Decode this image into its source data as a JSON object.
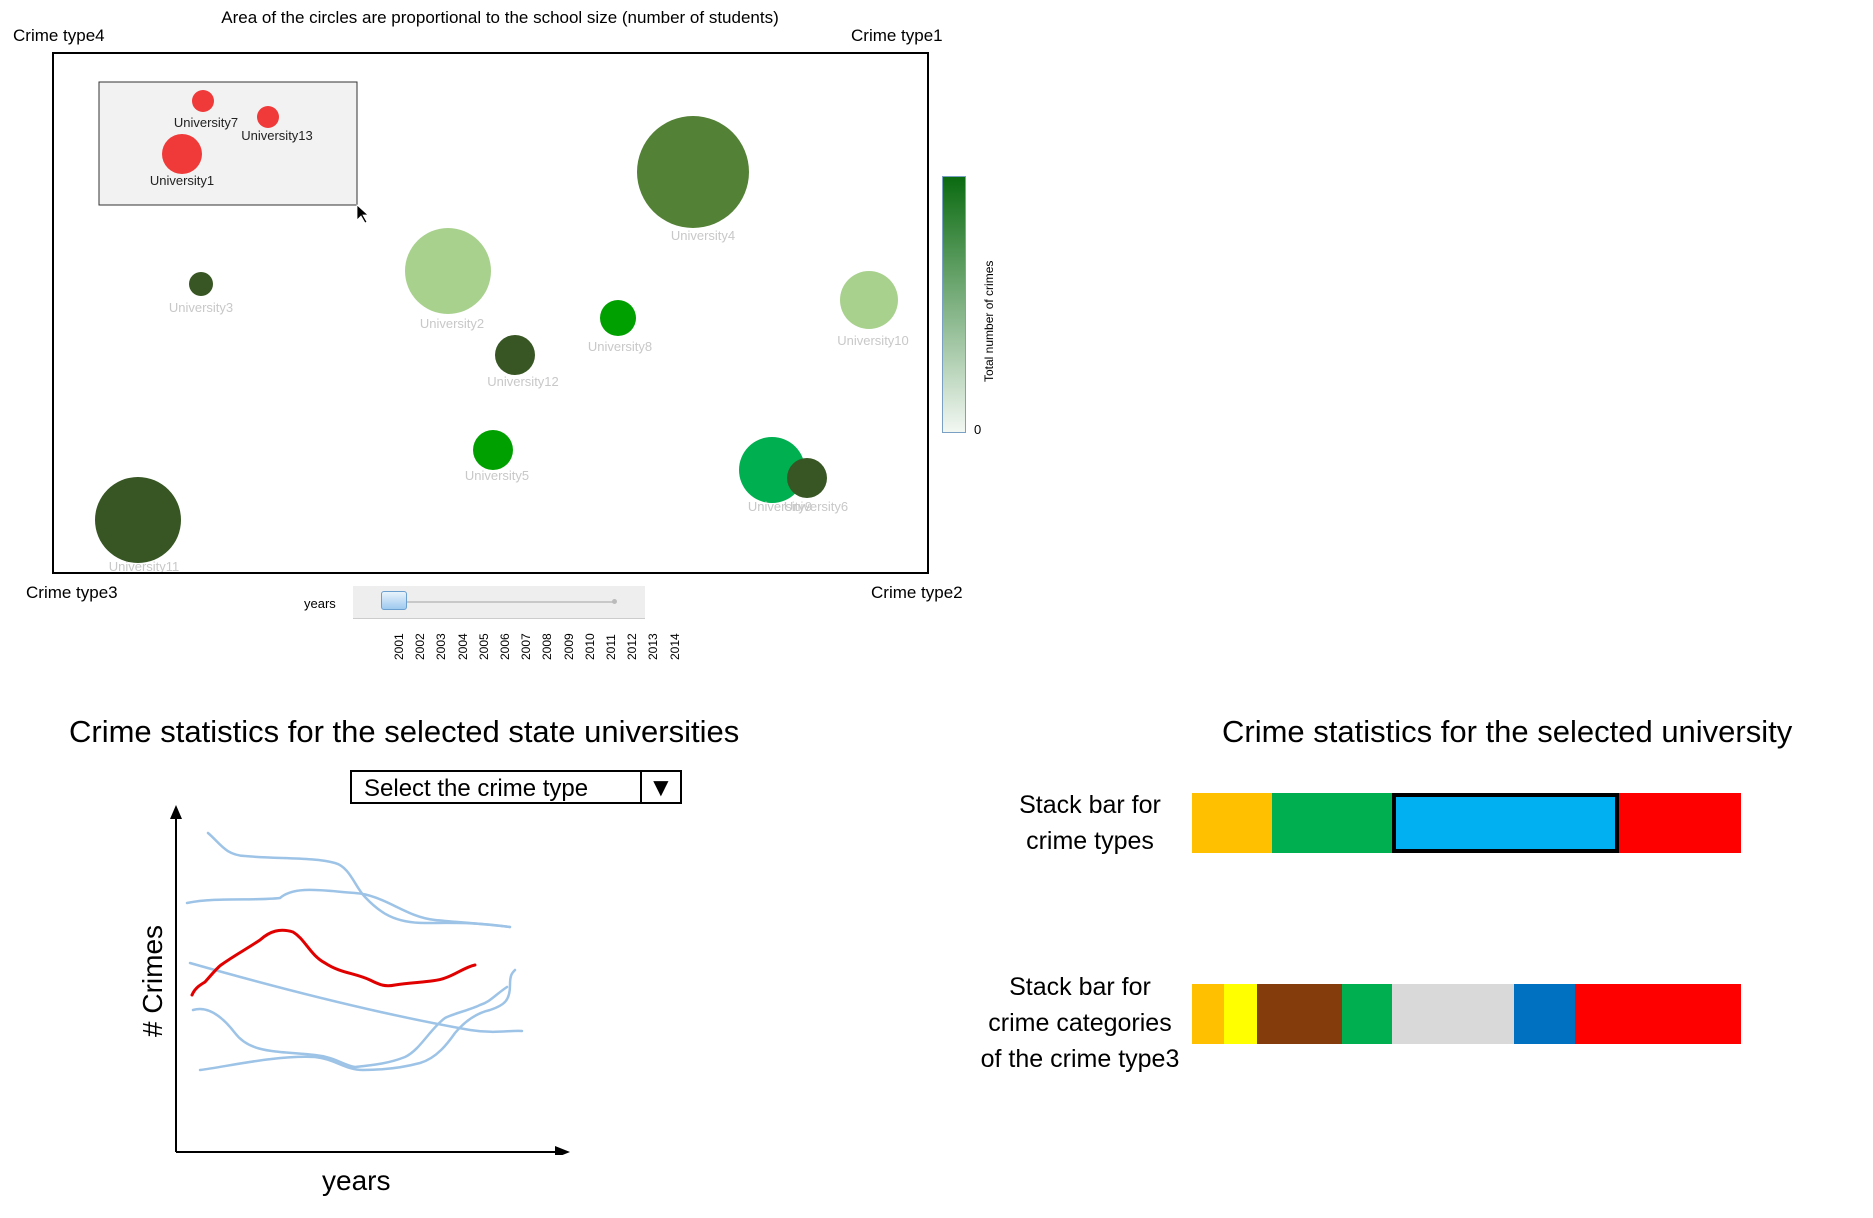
{
  "bubble_chart": {
    "caption": "Area of the circles are proportional to the school size (number of students)",
    "corners": {
      "top_left": "Crime type4",
      "top_right": "Crime type1",
      "bottom_left": "Crime type3",
      "bottom_right": "Crime type2"
    },
    "legend": {
      "title": "Total number of crimes",
      "min_label": "0",
      "colors": [
        "#0b6b11",
        "#f2f7f2"
      ]
    },
    "slider": {
      "label": "years",
      "selected": "2001",
      "years": [
        "2001",
        "2002",
        "2003",
        "2004",
        "2005",
        "2006",
        "2007",
        "2008",
        "2009",
        "2010",
        "2011",
        "2012",
        "2013",
        "2014"
      ]
    },
    "selected_universities": [
      "University7",
      "University13",
      "University1"
    ],
    "universities": [
      {
        "name": "University7",
        "color": "#f03a3a",
        "selected": true
      },
      {
        "name": "University13",
        "color": "#f03a3a",
        "selected": true
      },
      {
        "name": "University1",
        "color": "#f03a3a",
        "selected": true
      },
      {
        "name": "University4",
        "color": "#538135",
        "selected": false
      },
      {
        "name": "University3",
        "color": "#375623",
        "selected": false
      },
      {
        "name": "University2",
        "color": "#a9d18e",
        "selected": false
      },
      {
        "name": "University8",
        "color": "#00a000",
        "selected": false
      },
      {
        "name": "University10",
        "color": "#a9d18e",
        "selected": false
      },
      {
        "name": "University12",
        "color": "#375623",
        "selected": false
      },
      {
        "name": "University5",
        "color": "#00a000",
        "selected": false
      },
      {
        "name": "University9",
        "color": "#00b050",
        "selected": false
      },
      {
        "name": "University6",
        "color": "#375623",
        "selected": false
      },
      {
        "name": "University11",
        "color": "#375623",
        "selected": false
      }
    ]
  },
  "left_panel": {
    "title": "Crime statistics for the selected state universities",
    "select_label": "Select the crime type",
    "select_arrow": "▼",
    "y_label": "# Crimes",
    "x_label": "years",
    "highlight_color": "#e00000",
    "line_color": "#9dc3e6"
  },
  "right_panel": {
    "title": "Crime statistics for the selected university",
    "bar1": {
      "label_line1": "Stack bar for",
      "label_line2": "crime types",
      "segments": [
        {
          "color": "#ffc000",
          "share": 0.146
        },
        {
          "color": "#00b050",
          "share": 0.218
        },
        {
          "color": "#00b0f0",
          "share": 0.414,
          "highlighted": true
        },
        {
          "color": "#ff0000",
          "share": 0.222
        }
      ]
    },
    "bar2": {
      "label_line1": "Stack bar for",
      "label_line2": "crime categories",
      "label_line3": "of the crime type3",
      "segments": [
        {
          "color": "#ffc000",
          "share": 0.059
        },
        {
          "color": "#ffff00",
          "share": 0.059
        },
        {
          "color": "#843c0c",
          "share": 0.156
        },
        {
          "color": "#00b050",
          "share": 0.091
        },
        {
          "color": "#d9d9d9",
          "share": 0.221
        },
        {
          "color": "#0070c0",
          "share": 0.111
        },
        {
          "color": "#ff0000",
          "share": 0.303
        }
      ]
    }
  }
}
